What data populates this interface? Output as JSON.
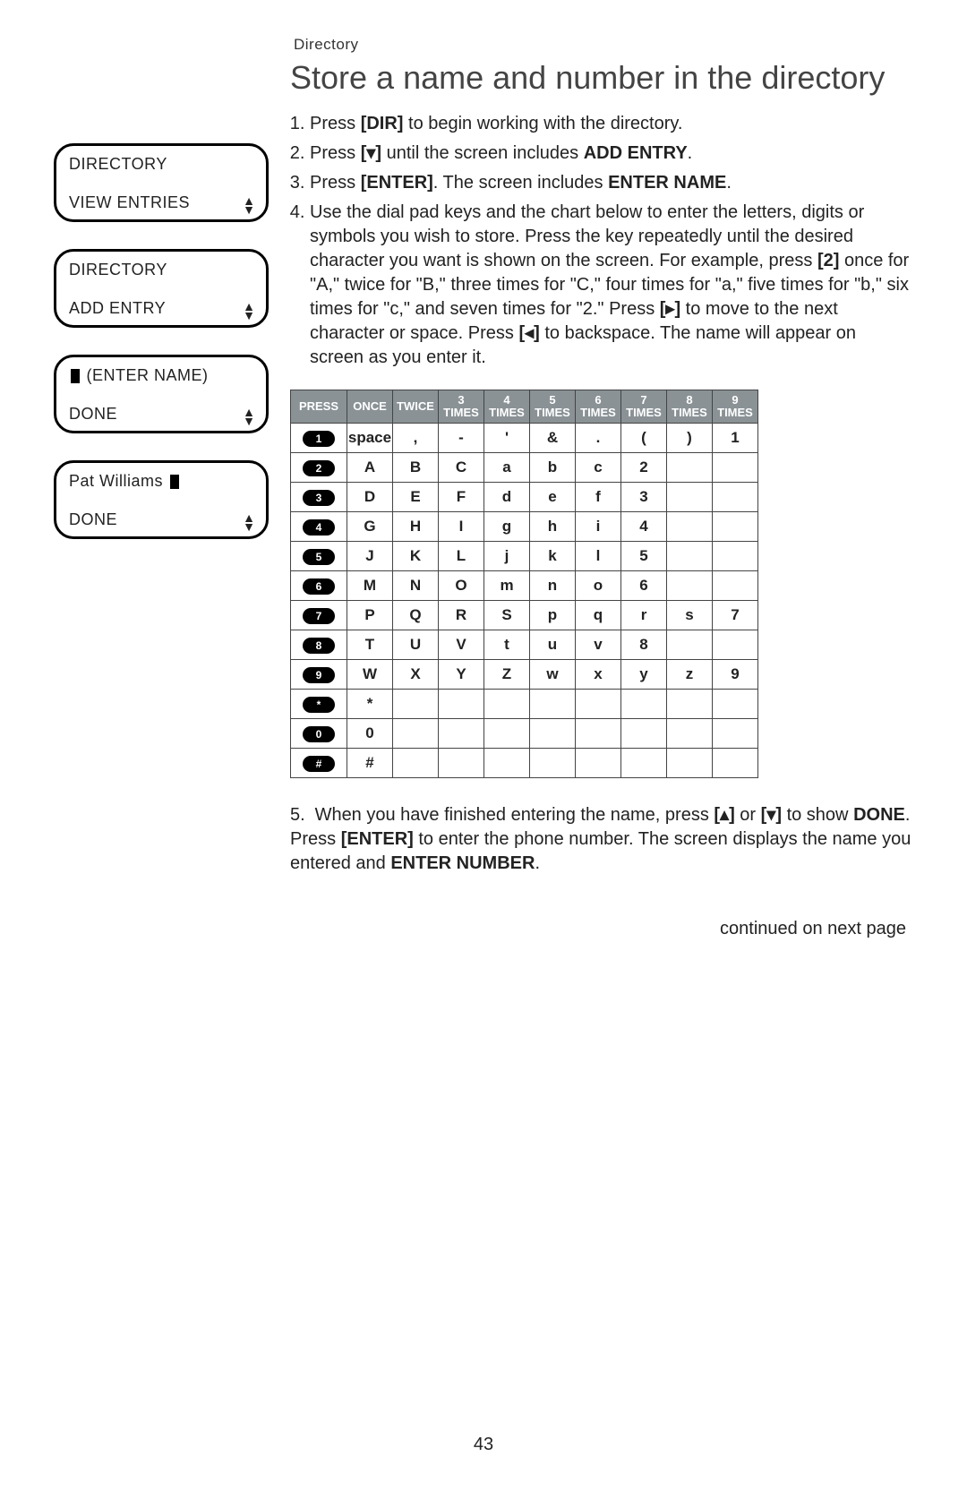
{
  "header": {
    "section": "Directory"
  },
  "title": "Store a name and number in the directory",
  "steps": {
    "s1a": "Press ",
    "s1b": "[DIR]",
    "s1c": " to begin working with the directory.",
    "s2a": "Press ",
    "s2b": "[▾]",
    "s2c": " until the screen includes ",
    "s2d": "ADD ENTRY",
    "s2e": ".",
    "s3a": "Press ",
    "s3b": "[ENTER]",
    "s3c": ". The screen includes ",
    "s3d": "ENTER NAME",
    "s3e": ".",
    "s4a": "Use the dial pad keys and the chart below to enter the letters, digits or symbols you wish to store. Press the key repeatedly until the desired character you want is shown on the screen. For example, press ",
    "s4b": "[2]",
    "s4c": " once for \"A,\" twice for \"B,\" three times for \"C,\" four times for \"a,\" five times for \"b,\" six times for \"c,\" and seven times for \"2.\" Press ",
    "s4d": "[▸]",
    "s4e": " to move to the next character or space. Press ",
    "s4f": "[◂]",
    "s4g": " to backspace. The name will appear on screen as you enter it."
  },
  "lcd": [
    {
      "line1": "DIRECTORY",
      "line2": "VIEW ENTRIES"
    },
    {
      "line1": "DIRECTORY",
      "line2": "ADD ENTRY"
    },
    {
      "line1": "(ENTER NAME)",
      "line2": "DONE",
      "cursorTop": true
    },
    {
      "line1": "Pat Williams",
      "line2": "DONE",
      "cursorAfter": true
    }
  ],
  "chart": {
    "headers": [
      "PRESS",
      "ONCE",
      "TWICE",
      "3 TIMES",
      "4 TIMES",
      "5 TIMES",
      "6 TIMES",
      "7 TIMES",
      "8 TIMES",
      "9 TIMES"
    ],
    "rows": [
      {
        "key": "1",
        "cells": [
          "space",
          ",",
          "-",
          "'",
          "&",
          ".",
          "(",
          ")",
          "1"
        ]
      },
      {
        "key": "2",
        "cells": [
          "A",
          "B",
          "C",
          "a",
          "b",
          "c",
          "2",
          "",
          ""
        ]
      },
      {
        "key": "3",
        "cells": [
          "D",
          "E",
          "F",
          "d",
          "e",
          "f",
          "3",
          "",
          ""
        ]
      },
      {
        "key": "4",
        "cells": [
          "G",
          "H",
          "I",
          "g",
          "h",
          "i",
          "4",
          "",
          ""
        ]
      },
      {
        "key": "5",
        "cells": [
          "J",
          "K",
          "L",
          "j",
          "k",
          "l",
          "5",
          "",
          ""
        ]
      },
      {
        "key": "6",
        "cells": [
          "M",
          "N",
          "O",
          "m",
          "n",
          "o",
          "6",
          "",
          ""
        ]
      },
      {
        "key": "7",
        "cells": [
          "P",
          "Q",
          "R",
          "S",
          "p",
          "q",
          "r",
          "s",
          "7"
        ]
      },
      {
        "key": "8",
        "cells": [
          "T",
          "U",
          "V",
          "t",
          "u",
          "v",
          "8",
          "",
          ""
        ]
      },
      {
        "key": "9",
        "cells": [
          "W",
          "X",
          "Y",
          "Z",
          "w",
          "x",
          "y",
          "z",
          "9"
        ]
      },
      {
        "key": "*",
        "cells": [
          "*",
          "",
          "",
          "",
          "",
          "",
          "",
          "",
          ""
        ]
      },
      {
        "key": "0",
        "cells": [
          "0",
          "",
          "",
          "",
          "",
          "",
          "",
          "",
          ""
        ]
      },
      {
        "key": "#",
        "cells": [
          "#",
          "",
          "",
          "",
          "",
          "",
          "",
          "",
          ""
        ]
      }
    ]
  },
  "step5": {
    "num": "5.",
    "a": "When you have finished entering the name, press ",
    "b": "[▴]",
    "c": " or ",
    "d": "[▾]",
    "e": " to show ",
    "f": "DONE",
    "g": ". Press ",
    "h": "[ENTER]",
    "i": " to enter the phone number. The screen displays the name you entered and ",
    "j": "ENTER NUMBER",
    "k": "."
  },
  "continued": "continued on next page",
  "pageNumber": "43"
}
